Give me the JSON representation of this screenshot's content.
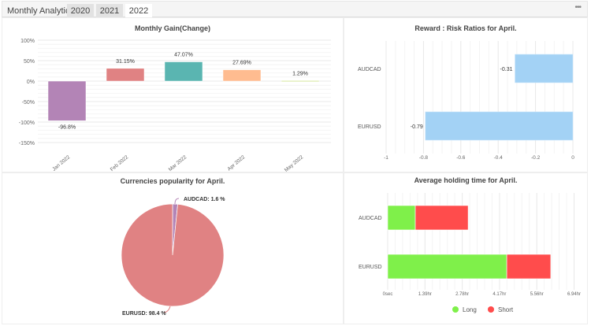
{
  "header": {
    "title": "Monthly Analytics",
    "tabs": [
      {
        "label": "2020"
      },
      {
        "label": "2021"
      },
      {
        "label": "2022",
        "active": true
      }
    ],
    "more_icon": "ellipsis-icon"
  },
  "chart_data": [
    {
      "type": "bar",
      "title": "Monthly Gain(Change)",
      "categories": [
        "Jan 2022",
        "Feb 2022",
        "Mar 2022",
        "Apr 2022",
        "May 2022"
      ],
      "values": [
        -96.8,
        31.15,
        47.07,
        27.69,
        1.29
      ],
      "labels": [
        "-96.8%",
        "31.15%",
        "47.07%",
        "27.69%",
        "1.29%"
      ],
      "colors": [
        "#b384b6",
        "#e08283",
        "#5ab5b1",
        "#ffbc90",
        "#d4e59c"
      ],
      "ylim": [
        -150,
        100
      ],
      "yticks": [
        "100%",
        "50%",
        "0%",
        "-50%",
        "-100%",
        "-150%"
      ],
      "grid": true
    },
    {
      "type": "bar",
      "orientation": "horizontal",
      "title": "Reward : Risk Ratios for April.",
      "categories": [
        "AUDCAD",
        "EURUSD"
      ],
      "values": [
        -0.31,
        -0.79
      ],
      "labels": [
        "-0.31",
        "-0.79"
      ],
      "color": "#a3d2f5",
      "xlim": [
        -1,
        0
      ],
      "xticks": [
        "-1",
        "-0.8",
        "-0.6",
        "-0.4",
        "-0.2",
        "0"
      ],
      "grid": true
    },
    {
      "type": "pie",
      "title": "Currencies popularity for April.",
      "slices": [
        {
          "label": "AUDCAD: 1.6 %",
          "value": 1.6,
          "color": "#b384b6"
        },
        {
          "label": "EURUSD: 98.4 %",
          "value": 98.4,
          "color": "#e08283"
        }
      ]
    },
    {
      "type": "bar",
      "orientation": "horizontal",
      "stacked": true,
      "title": "Average holding time for April.",
      "categories": [
        "AUDCAD",
        "EURUSD"
      ],
      "series": [
        {
          "name": "Long",
          "values": [
            1.03,
            4.44
          ],
          "color": "#7ff04a"
        },
        {
          "name": "Short",
          "values": [
            1.97,
            1.64
          ],
          "color": "#ff4c4c"
        }
      ],
      "unit": "hr",
      "xlim": [
        0,
        6.94
      ],
      "xticks": [
        "0sec",
        "1.39hr",
        "2.78hr",
        "4.17hr",
        "5.56hr",
        "6.94hr"
      ],
      "legend": "bottom",
      "grid": true
    }
  ]
}
